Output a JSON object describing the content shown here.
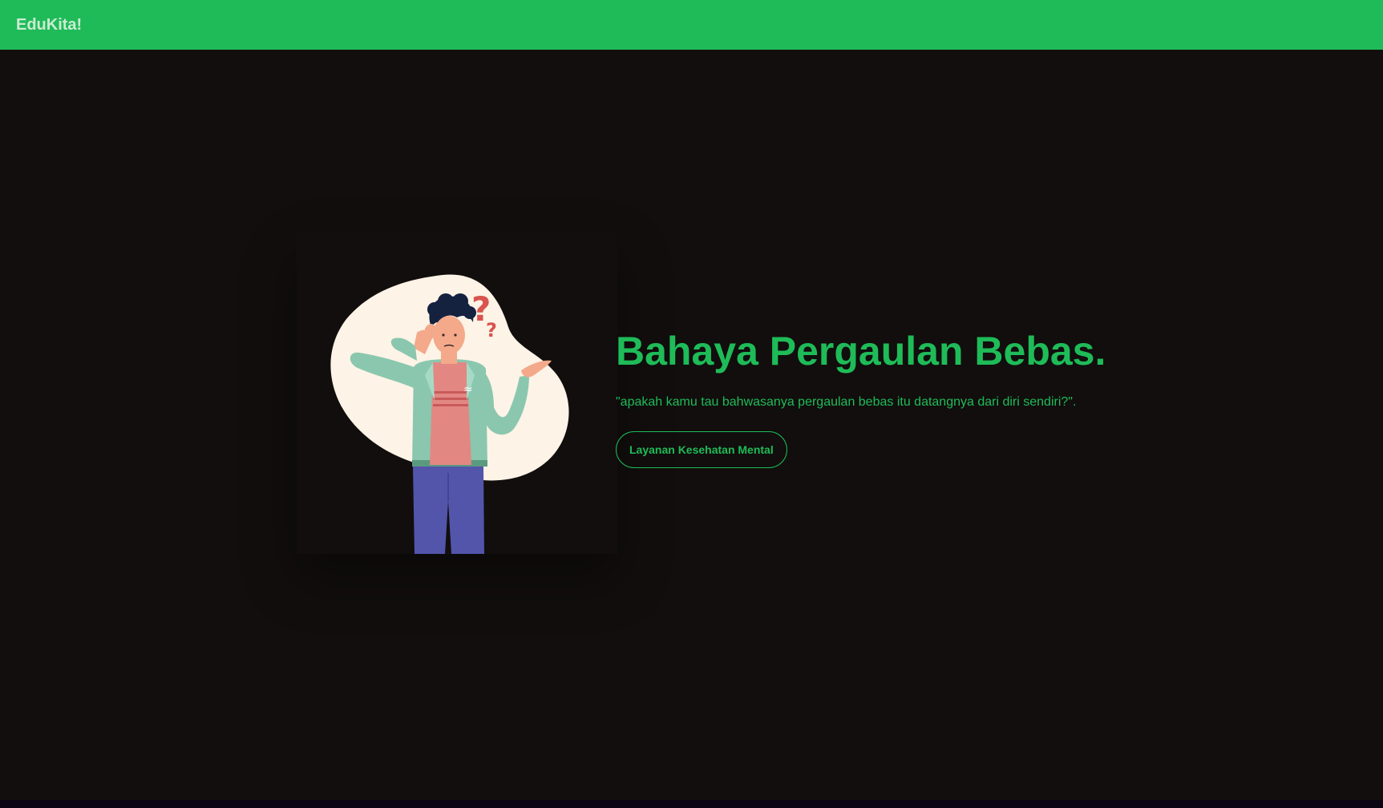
{
  "navbar": {
    "brand": "EduKita!"
  },
  "hero": {
    "title": "Bahaya Pergaulan Bebas.",
    "quote": "\"apakah kamu tau bahwasanya pergaulan bebas itu datangnya dari diri sendiri?\".",
    "button_label": "Layanan Kesehatan Mental",
    "illustration_marks": [
      "?",
      "?"
    ]
  },
  "colors": {
    "accent": "#1fbb58",
    "navbar_bg": "#1fbb58",
    "brand_text": "#c9ecd2",
    "page_bg": "#110e0d",
    "blob": "#fdf3e6",
    "jacket": "#8ac7ae",
    "shirt": "#e38783",
    "pants": "#5355aa",
    "hair": "#14213f",
    "question_mark": "#d9534f"
  }
}
